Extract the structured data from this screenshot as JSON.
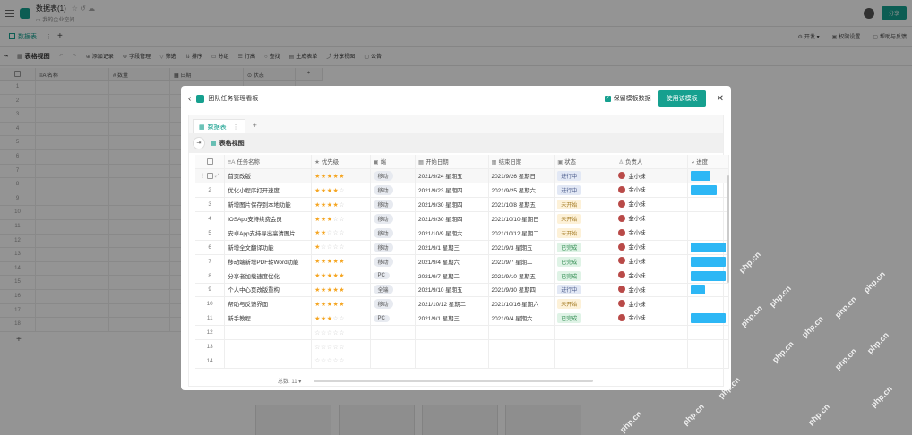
{
  "app": {
    "doc_title": "数据表(1)",
    "doc_subtitle": "我的企业空间",
    "share_label": "分享"
  },
  "tabbar": {
    "active_tab": "数据表",
    "right_items": [
      "开发",
      "权限设置",
      "帮助与反馈"
    ]
  },
  "toolbar": {
    "view_name": "表格视图",
    "items": [
      "添加记录",
      "字段管理",
      "筛选",
      "排序",
      "分组",
      "行高",
      "查找",
      "生成表单",
      "分享视图",
      "公告"
    ]
  },
  "background_grid": {
    "columns": [
      "名称",
      "数量",
      "日期",
      "状态"
    ],
    "row_numbers": [
      "1",
      "2",
      "3",
      "4",
      "5",
      "6",
      "7",
      "8",
      "9",
      "10",
      "11",
      "12",
      "13",
      "14",
      "15",
      "16",
      "17",
      "18"
    ]
  },
  "modal": {
    "title": "团队任务管理看板",
    "keep_label": "保留模板数据",
    "use_button": "使用该模板",
    "tab_label": "数据表",
    "view_name": "表格视图",
    "columns": [
      "任务名称",
      "优先级",
      "端",
      "开始日期",
      "结束日期",
      "状态",
      "负责人",
      "进度"
    ],
    "rows": [
      {
        "num": "1",
        "name": "首页改版",
        "stars": 5,
        "platform": "移动",
        "start": "2021/9/24 星期五",
        "end": "2021/9/26 星期日",
        "status": "进行中",
        "owner": "金小妹",
        "progress": 0.55
      },
      {
        "num": "2",
        "name": "优化小程序打开速度",
        "stars": 4,
        "platform": "移动",
        "start": "2021/9/23 星期四",
        "end": "2021/9/25 星期六",
        "status": "进行中",
        "owner": "金小妹",
        "progress": 0.75
      },
      {
        "num": "3",
        "name": "新增图片保存到本地功能",
        "stars": 4,
        "platform": "移动",
        "start": "2021/9/30 星期四",
        "end": "2021/10/8 星期五",
        "status": "未开始",
        "owner": "金小妹",
        "progress": 0
      },
      {
        "num": "4",
        "name": "iOSApp支持续费会员",
        "stars": 3,
        "platform": "移动",
        "start": "2021/9/30 星期四",
        "end": "2021/10/10 星期日",
        "status": "未开始",
        "owner": "金小妹",
        "progress": 0
      },
      {
        "num": "5",
        "name": "安卓App支持导出高清图片",
        "stars": 2,
        "platform": "移动",
        "start": "2021/10/9 星期六",
        "end": "2021/10/12 星期二",
        "status": "未开始",
        "owner": "金小妹",
        "progress": 0
      },
      {
        "num": "6",
        "name": "新增全文翻译功能",
        "stars": 1,
        "platform": "移动",
        "start": "2021/9/1 星期三",
        "end": "2021/9/3 星期五",
        "status": "已完成",
        "owner": "金小妹",
        "progress": 1
      },
      {
        "num": "7",
        "name": "移动端新增PDF转Word功能",
        "stars": 5,
        "platform": "移动",
        "start": "2021/9/4 星期六",
        "end": "2021/9/7 星期二",
        "status": "已完成",
        "owner": "金小妹",
        "progress": 1
      },
      {
        "num": "8",
        "name": "分享者加载速度优化",
        "stars": 5,
        "platform": "PC",
        "start": "2021/9/7 星期二",
        "end": "2021/9/10 星期五",
        "status": "已完成",
        "owner": "金小妹",
        "progress": 1
      },
      {
        "num": "9",
        "name": "个人中心页改版重构",
        "stars": 5,
        "platform": "全端",
        "start": "2021/9/10 星期五",
        "end": "2021/9/30 星期四",
        "status": "进行中",
        "owner": "金小妹",
        "progress": 0.4
      },
      {
        "num": "10",
        "name": "帮助与反馈界面",
        "stars": 5,
        "platform": "移动",
        "start": "2021/10/12 星期二",
        "end": "2021/10/16 星期六",
        "status": "未开始",
        "owner": "金小妹",
        "progress": 0
      },
      {
        "num": "11",
        "name": "新手教程",
        "stars": 3,
        "platform": "PC",
        "start": "2021/9/1 星期三",
        "end": "2021/9/4 星期六",
        "status": "已完成",
        "owner": "金小妹",
        "progress": 1
      },
      {
        "num": "12",
        "name": "",
        "stars": 0,
        "platform": "",
        "start": "",
        "end": "",
        "status": "",
        "owner": "",
        "progress": 0
      },
      {
        "num": "13",
        "name": "",
        "stars": 0,
        "platform": "",
        "start": "",
        "end": "",
        "status": "",
        "owner": "",
        "progress": 0
      },
      {
        "num": "14",
        "name": "",
        "stars": 0,
        "platform": "",
        "start": "",
        "end": "",
        "status": "",
        "owner": "",
        "progress": 0
      }
    ],
    "total_label": "总数: 11"
  },
  "watermark": "php.cn"
}
